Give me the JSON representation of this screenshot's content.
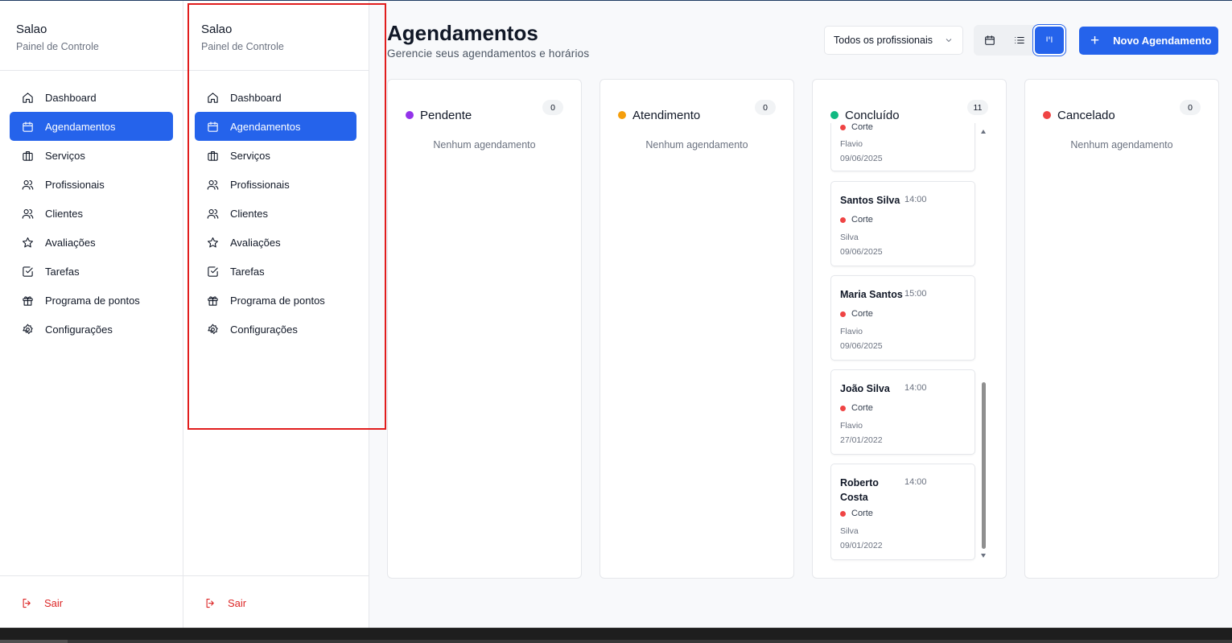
{
  "sidebar": {
    "title": "Salao",
    "subtitle": "Painel de Controle",
    "items": [
      {
        "label": "Dashboard",
        "icon": "home-icon",
        "active": false
      },
      {
        "label": "Agendamentos",
        "icon": "calendar-icon",
        "active": true
      },
      {
        "label": "Serviços",
        "icon": "briefcase-icon",
        "active": false
      },
      {
        "label": "Profissionais",
        "icon": "users-icon",
        "active": false
      },
      {
        "label": "Clientes",
        "icon": "users-icon",
        "active": false
      },
      {
        "label": "Avaliações",
        "icon": "star-icon",
        "active": false
      },
      {
        "label": "Tarefas",
        "icon": "check-square-icon",
        "active": false
      },
      {
        "label": "Programa de pontos",
        "icon": "gift-icon",
        "active": false
      },
      {
        "label": "Configurações",
        "icon": "gear-icon",
        "active": false
      }
    ],
    "logout_label": "Sair"
  },
  "header": {
    "title": "Agendamentos",
    "subtitle": "Gerencie seus agendamentos e horários",
    "filter_value": "Todos os profissionais",
    "new_button_label": "Novo Agendamento",
    "view_modes": [
      "calendar-icon",
      "list-icon",
      "kanban-icon"
    ],
    "active_view": "kanban"
  },
  "board": {
    "empty_text": "Nenhum agendamento",
    "columns": [
      {
        "title": "Pendente",
        "count": "0",
        "color": "#9333ea"
      },
      {
        "title": "Atendimento",
        "count": "0",
        "color": "#f59e0b"
      },
      {
        "title": "Concluído",
        "count": "11",
        "color": "#10b981"
      },
      {
        "title": "Cancelado",
        "count": "0",
        "color": "#ef4444"
      }
    ],
    "done_cards": [
      {
        "name": "",
        "time": "",
        "service": "Corte",
        "professional": "Flavio",
        "date": "09/06/2025"
      },
      {
        "name": "Santos Silva",
        "time": "14:00",
        "service": "Corte",
        "professional": "Silva",
        "date": "09/06/2025"
      },
      {
        "name": "Maria Santos",
        "time": "15:00",
        "service": "Corte",
        "professional": "Flavio",
        "date": "09/06/2025"
      },
      {
        "name": "João Silva",
        "time": "14:00",
        "service": "Corte",
        "professional": "Flavio",
        "date": "27/01/2022"
      },
      {
        "name": "Roberto Costa",
        "time": "14:00",
        "service": "Corte",
        "professional": "Silva",
        "date": "09/01/2022"
      }
    ]
  },
  "colors": {
    "accent": "#2563eb",
    "danger": "#dc2626"
  }
}
